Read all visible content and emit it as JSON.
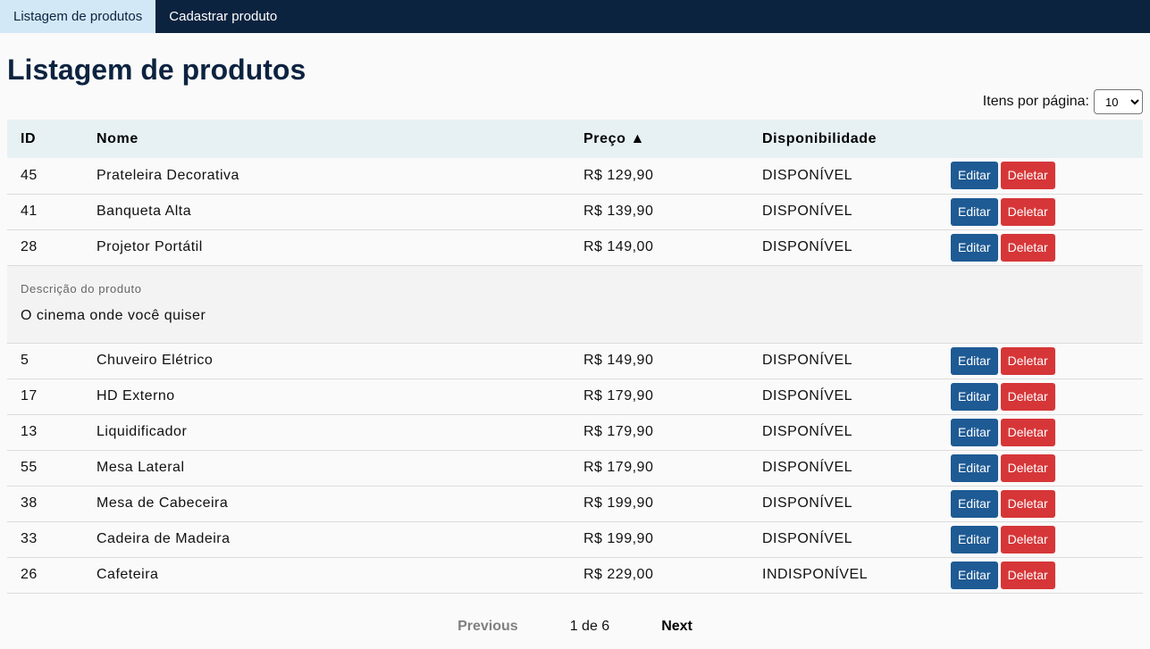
{
  "nav": {
    "tabs": [
      {
        "label": "Listagem de produtos"
      },
      {
        "label": "Cadastrar produto"
      }
    ]
  },
  "page": {
    "title": "Listagem de produtos",
    "per_page_label": "Itens por página:",
    "per_page_value": "10"
  },
  "table": {
    "headers": {
      "id": "ID",
      "name": "Nome",
      "price": "Preço ▲",
      "availability": "Disponibilidade"
    },
    "edit_label": "Editar",
    "delete_label": "Deletar",
    "rows": [
      {
        "id": "45",
        "name": "Prateleira Decorativa",
        "price": "R$ 129,90",
        "availability": "DISPONÍVEL"
      },
      {
        "id": "41",
        "name": "Banqueta Alta",
        "price": "R$ 139,90",
        "availability": "DISPONÍVEL"
      },
      {
        "id": "28",
        "name": "Projetor Portátil",
        "price": "R$ 149,00",
        "availability": "DISPONÍVEL"
      },
      {
        "id": "5",
        "name": "Chuveiro Elétrico",
        "price": "R$ 149,90",
        "availability": "DISPONÍVEL"
      },
      {
        "id": "17",
        "name": "HD Externo",
        "price": "R$ 179,90",
        "availability": "DISPONÍVEL"
      },
      {
        "id": "13",
        "name": "Liquidificador",
        "price": "R$ 179,90",
        "availability": "DISPONÍVEL"
      },
      {
        "id": "55",
        "name": "Mesa Lateral",
        "price": "R$ 179,90",
        "availability": "DISPONÍVEL"
      },
      {
        "id": "38",
        "name": "Mesa de Cabeceira",
        "price": "R$ 199,90",
        "availability": "DISPONÍVEL"
      },
      {
        "id": "33",
        "name": "Cadeira de Madeira",
        "price": "R$ 199,90",
        "availability": "DISPONÍVEL"
      },
      {
        "id": "26",
        "name": "Cafeteira",
        "price": "R$ 229,00",
        "availability": "INDISPONÍVEL"
      }
    ],
    "expanded": {
      "label": "Descrição do produto",
      "text": "O cinema onde você quiser"
    }
  },
  "pagination": {
    "previous": "Previous",
    "info": "1 de 6",
    "next": "Next"
  }
}
